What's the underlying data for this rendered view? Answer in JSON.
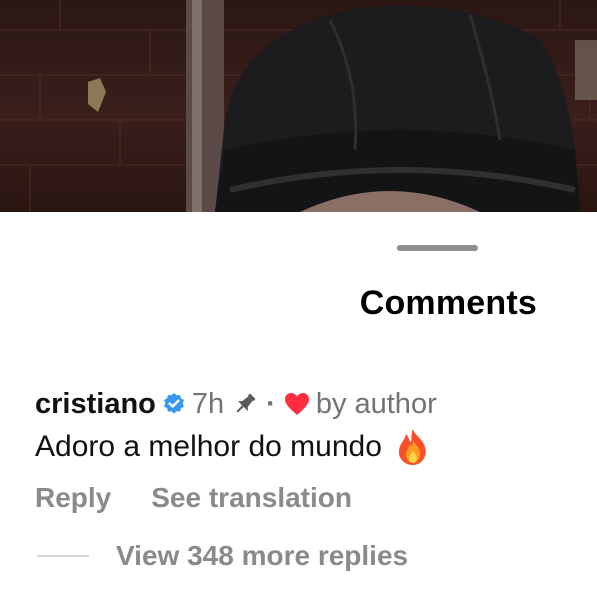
{
  "sheet": {
    "title": "Comments"
  },
  "comment": {
    "username": "cristiano",
    "time": "7h",
    "separator": "·",
    "liked_by": "by author",
    "text": "Adoro a melhor do mundo",
    "reply_label": "Reply",
    "translate_label": "See translation",
    "view_replies_label": "View 348 more replies"
  },
  "icons": {
    "verified": "verified-badge-icon",
    "pin": "pin-icon",
    "heart": "heart-icon",
    "emoji": "fire-emoji-icon"
  },
  "colors": {
    "verified_blue": "#3897f0",
    "heart_red": "#ff2d3f",
    "secondary_text": "#737373",
    "action_text": "#8a8a8a"
  }
}
